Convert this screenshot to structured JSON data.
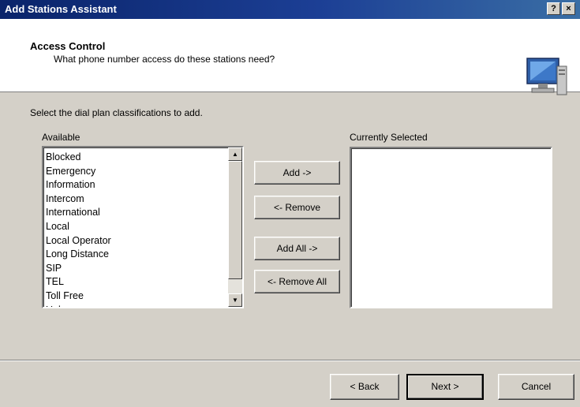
{
  "window": {
    "title": "Add Stations Assistant",
    "help_button": "?",
    "close_button": "×"
  },
  "header": {
    "title": "Access Control",
    "subtitle": "What phone number access do these stations need?",
    "icon": "monitor-icon"
  },
  "instructions": "Select the dial plan classifications to add.",
  "available": {
    "label": "Available",
    "items": [
      "Blocked",
      "Emergency",
      "Information",
      "Intercom",
      "International",
      "Local",
      "Local Operator",
      "Long Distance",
      "SIP",
      "TEL",
      "Toll Free",
      "Unknown"
    ]
  },
  "selected": {
    "label": "Currently Selected",
    "items": []
  },
  "transfer_buttons": {
    "add": "Add ->",
    "remove": "<- Remove",
    "add_all": "Add All ->",
    "remove_all": "<- Remove All"
  },
  "footer": {
    "back": "< Back",
    "next": "Next >",
    "cancel": "Cancel"
  },
  "scrollbar": {
    "up_arrow": "▲",
    "down_arrow": "▼"
  }
}
